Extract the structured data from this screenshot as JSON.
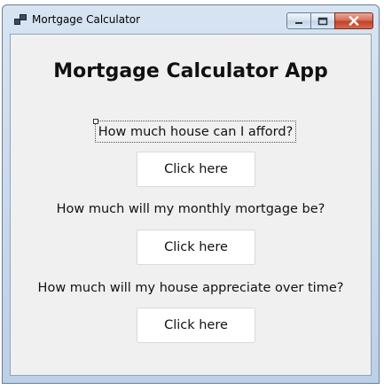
{
  "window": {
    "title": "Mortgage Calculator"
  },
  "main": {
    "heading": "Mortgage Calculator App",
    "sections": [
      {
        "question": "How much house can I afford?",
        "button_label": "Click here"
      },
      {
        "question": "How much will my monthly mortgage be?",
        "button_label": "Click here"
      },
      {
        "question": "How much will my house appreciate over time?",
        "button_label": "Click here"
      }
    ]
  },
  "icons": {
    "app": "app-icon",
    "minimize": "minimize-icon",
    "maximize": "maximize-icon",
    "close": "close-icon"
  }
}
